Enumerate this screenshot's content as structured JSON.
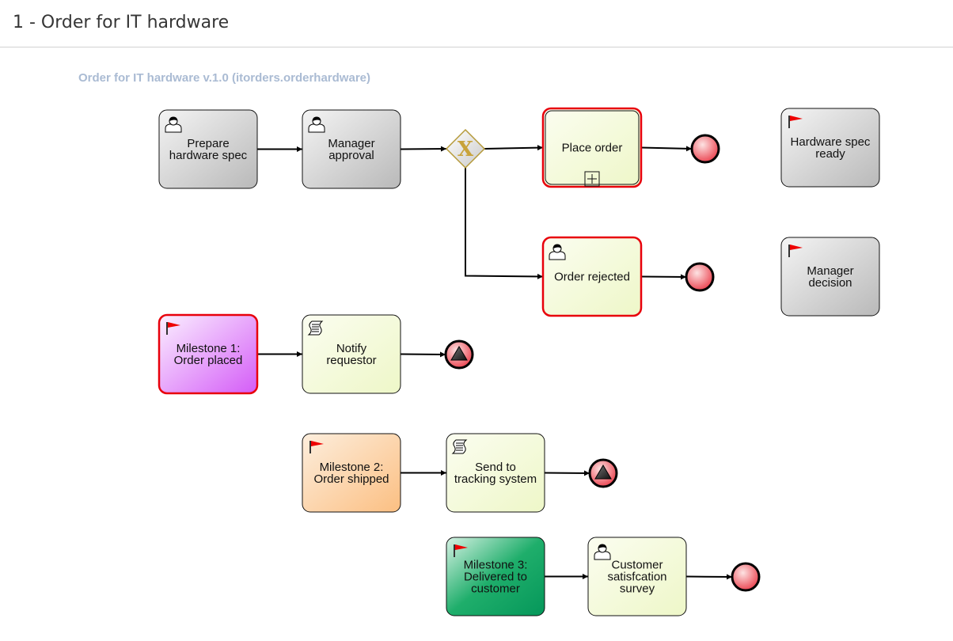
{
  "header": {
    "title": "1 - Order for IT hardware"
  },
  "diagram": {
    "caption": "Order for IT hardware v.1.0 (itorders.orderhardware)",
    "nodes": [
      {
        "id": "prepare",
        "type": "user-task",
        "lines": [
          "Prepare",
          "hardware spec"
        ],
        "fill": "grey",
        "active": false
      },
      {
        "id": "manager",
        "type": "user-task",
        "lines": [
          "Manager",
          "approval"
        ],
        "fill": "grey",
        "active": false
      },
      {
        "id": "gateway",
        "type": "exclusive-gateway",
        "lines": []
      },
      {
        "id": "place",
        "type": "subprocess",
        "lines": [
          "Place order"
        ],
        "fill": "yellow",
        "active": true
      },
      {
        "id": "place_end",
        "type": "end-event",
        "lines": []
      },
      {
        "id": "rejected",
        "type": "user-task",
        "lines": [
          "Order rejected"
        ],
        "fill": "yellow",
        "active": true
      },
      {
        "id": "rejected_end",
        "type": "end-event",
        "lines": []
      },
      {
        "id": "hw_ready",
        "type": "milestone",
        "lines": [
          "Hardware spec",
          "ready"
        ],
        "fill": "grey",
        "active": false
      },
      {
        "id": "mgr_decision",
        "type": "milestone",
        "lines": [
          "Manager",
          "decision"
        ],
        "fill": "grey",
        "active": false
      },
      {
        "id": "ms1",
        "type": "milestone",
        "lines": [
          "Milestone 1:",
          "Order placed"
        ],
        "fill": "purple",
        "active": true
      },
      {
        "id": "notify",
        "type": "script-task",
        "lines": [
          "Notify",
          "requestor"
        ],
        "fill": "yellow",
        "active": false
      },
      {
        "id": "notify_end",
        "type": "signal-end-event",
        "lines": []
      },
      {
        "id": "ms2",
        "type": "milestone",
        "lines": [
          "Milestone 2:",
          "Order shipped"
        ],
        "fill": "orange",
        "active": false
      },
      {
        "id": "tracking",
        "type": "script-task",
        "lines": [
          "Send to",
          "tracking system"
        ],
        "fill": "yellow",
        "active": false
      },
      {
        "id": "tracking_end",
        "type": "signal-end-event",
        "lines": []
      },
      {
        "id": "ms3",
        "type": "milestone",
        "lines": [
          "Milestone 3:",
          "Delivered to",
          "customer"
        ],
        "fill": "green",
        "active": false
      },
      {
        "id": "survey",
        "type": "user-task",
        "lines": [
          "Customer",
          "satisfcation",
          "survey"
        ],
        "fill": "yellow",
        "active": false
      },
      {
        "id": "survey_end",
        "type": "end-event",
        "lines": []
      }
    ],
    "edges": [
      [
        "prepare",
        "manager"
      ],
      [
        "manager",
        "gateway"
      ],
      [
        "gateway",
        "place"
      ],
      [
        "place",
        "place_end"
      ],
      [
        "gateway",
        "rejected"
      ],
      [
        "rejected",
        "rejected_end"
      ],
      [
        "ms1",
        "notify"
      ],
      [
        "notify",
        "notify_end"
      ],
      [
        "ms2",
        "tracking"
      ],
      [
        "tracking",
        "tracking_end"
      ],
      [
        "ms3",
        "survey"
      ],
      [
        "survey",
        "survey_end"
      ]
    ]
  }
}
